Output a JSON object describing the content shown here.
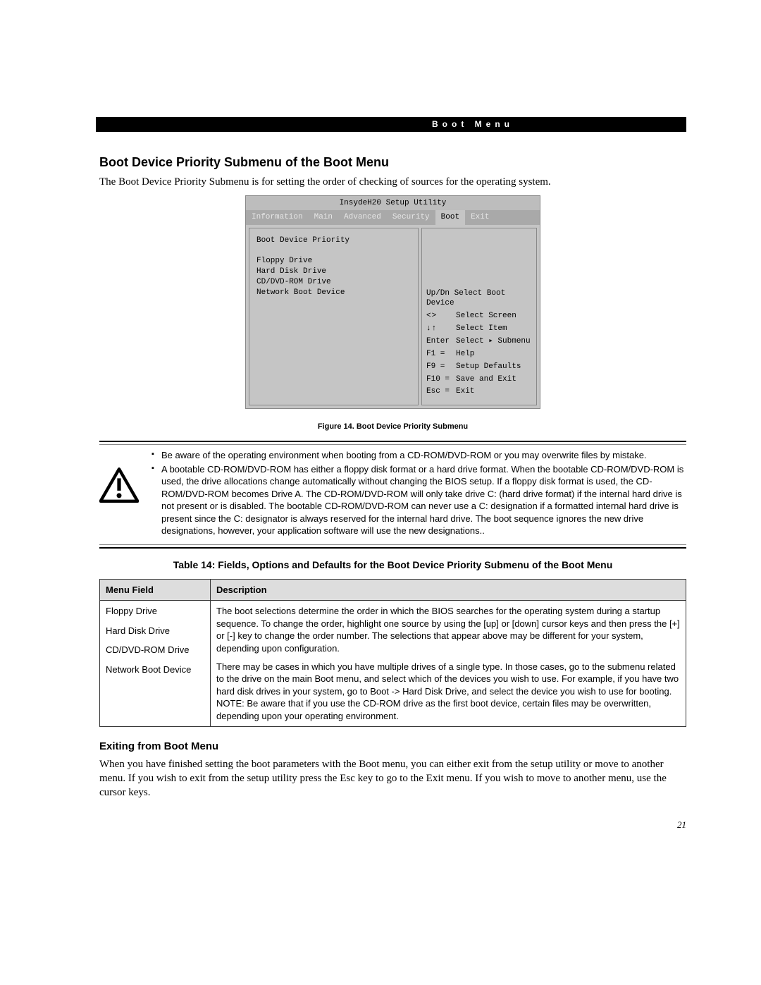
{
  "header": {
    "tab": "Boot Menu"
  },
  "h2": "Boot Device Priority Submenu of the Boot Menu",
  "intro": "The Boot Device Priority Submenu is for setting the order of checking of sources for the operating system.",
  "bios": {
    "title": "InsydeH20 Setup Utility",
    "tabs": [
      "Information",
      "Main",
      "Advanced",
      "Security",
      "Boot",
      "Exit"
    ],
    "selected_tab": "Boot",
    "main_header": "Boot Device Priority",
    "items": [
      "Floppy Drive",
      "Hard Disk Drive",
      "CD/DVD-ROM Drive",
      "Network Boot Device"
    ],
    "help_first": "Up/Dn Select Boot Device",
    "help": [
      {
        "k": "<>",
        "v": "Select Screen"
      },
      {
        "k": "↓↑",
        "v": "Select Item"
      },
      {
        "k": "Enter",
        "v": "Select ▸ Submenu"
      },
      {
        "k": "F1  =",
        "v": "Help"
      },
      {
        "k": "F9  =",
        "v": "Setup Defaults"
      },
      {
        "k": "F10 =",
        "v": "Save and Exit"
      },
      {
        "k": "Esc =",
        "v": "Exit"
      }
    ]
  },
  "figure_caption": "Figure 14.  Boot Device Priority Submenu",
  "notes": [
    "Be aware of the operating environment when booting from a CD-ROM/DVD-ROM or you may overwrite files by mistake.",
    "A bootable CD-ROM/DVD-ROM has either a floppy disk format or a hard drive format.  When the bootable CD-ROM/DVD-ROM is used, the drive allocations change automatically without changing the BIOS setup.  If a floppy disk format is used, the CD-ROM/DVD-ROM becomes Drive A.  The CD-ROM/DVD-ROM will only take drive C: (hard drive format) if the internal hard drive is not present or is disabled.  The bootable CD-ROM/DVD-ROM can never use a C: designation if a formatted internal hard drive is present since the C: designator is always reserved for the internal hard drive. The boot sequence ignores the new drive designations, however, your application software will use the new designations.."
  ],
  "table_title": "Table 14: Fields, Options and Defaults for the Boot Device Priority Submenu of the Boot Menu",
  "table": {
    "headers": [
      "Menu Field",
      "Description"
    ],
    "menu_items": [
      "Floppy Drive",
      "Hard Disk Drive",
      "CD/DVD-ROM Drive",
      "Network Boot Device"
    ],
    "desc1": "The boot selections determine the order in which the BIOS searches for the operating system during a startup sequence. To change the order, highlight one source by using the [up] or [down] cursor keys and then press the [+] or [-] key to change the order number. The selections that appear above may be different for your system, depending upon configuration.",
    "desc2": "There may be cases in which you have multiple drives of a single type. In those cases, go to the submenu related to the drive on the main Boot menu, and select which of the devices you wish to use. For example, if you have two hard disk drives in your system, go to Boot -> Hard Disk Drive, and select the device you wish to use for booting.",
    "desc3": "NOTE: Be aware that if you use the CD-ROM drive as the first boot device, certain files may be overwritten, depending upon your operating environment."
  },
  "exit_heading": "Exiting from Boot Menu",
  "exit_body": "When you have finished setting the boot parameters with the Boot menu, you can either exit from the setup utility or move to another menu. If you wish to exit from the setup utility press the Esc key to go to the Exit menu. If you wish to move to another menu, use the cursor keys.",
  "page_number": "21"
}
